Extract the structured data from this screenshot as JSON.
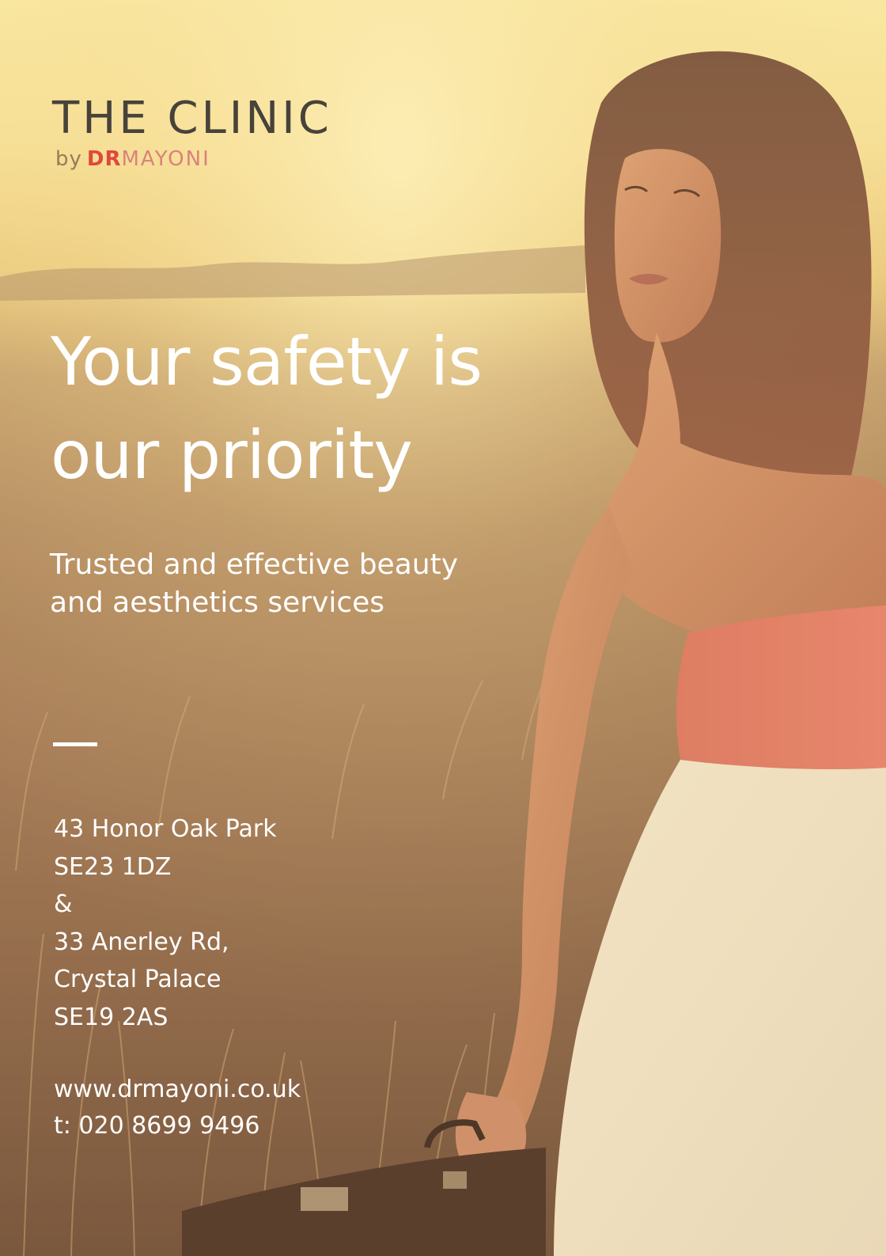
{
  "brand": {
    "title": "THE CLINIC",
    "by": "by",
    "dr": "DR",
    "name": "MAYONI"
  },
  "headline": {
    "line1": "Your safety is",
    "line2": "our priority"
  },
  "subheadline": {
    "line1": "Trusted and effective beauty",
    "line2": "and aesthetics services"
  },
  "address": {
    "lines": [
      "43 Honor Oak Park",
      "SE23 1DZ",
      "&",
      "33 Anerley Rd,",
      "Crystal Palace",
      "SE19 2AS"
    ]
  },
  "contact": {
    "website": "www.drmayoni.co.uk",
    "phone": "t: 020 8699 9496"
  },
  "colors": {
    "brand_red": "#e0483c",
    "logo_gray": "#47423a",
    "text_white": "#ffffff"
  }
}
